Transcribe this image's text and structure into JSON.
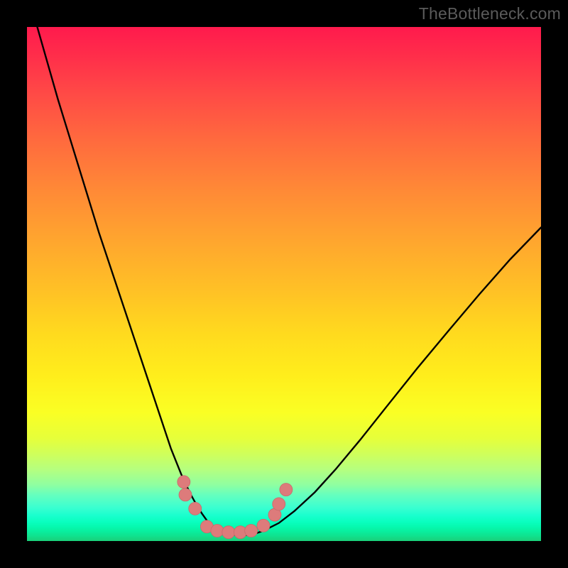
{
  "watermark": {
    "text": "TheBottleneck.com"
  },
  "colors": {
    "curve": "#000000",
    "markerFill": "#dd7b7b",
    "markerStroke": "#c86a6a",
    "gradientTop": "#ff1a4d",
    "gradientBottom": "#1ad07a"
  },
  "chart_data": {
    "type": "line",
    "title": "",
    "subtitle": "",
    "xlabel": "",
    "ylabel": "",
    "xlim": [
      0,
      100
    ],
    "ylim": [
      0,
      100
    ],
    "grid": false,
    "legend": false,
    "annotations": [],
    "series": [
      {
        "name": "bottleneck-curve",
        "x": [
          2,
          4,
          6,
          8,
          10,
          12,
          14,
          16,
          18,
          20,
          22,
          23.5,
          25,
          26,
          27,
          28,
          29,
          30,
          31,
          32,
          33,
          34,
          35,
          36,
          38,
          40,
          42,
          44,
          46,
          49,
          52,
          56,
          60,
          65,
          70,
          76,
          82,
          88,
          94,
          100
        ],
        "y": [
          100,
          93,
          86,
          79.5,
          73,
          66.5,
          60,
          54,
          48,
          42,
          36,
          31.5,
          27,
          24,
          21,
          18,
          15.5,
          13,
          10.8,
          8.8,
          7,
          5.4,
          4,
          3,
          1.8,
          1.2,
          1.1,
          1.3,
          2,
          3.5,
          5.8,
          9.5,
          13.9,
          19.9,
          26.2,
          33.7,
          40.9,
          48,
          54.8,
          61
        ]
      }
    ],
    "markers": [
      {
        "name": "left-pair-upper",
        "x": 30.5,
        "y": 11.5,
        "r": 9
      },
      {
        "name": "left-pair-lower",
        "x": 30.8,
        "y": 9.0,
        "r": 9
      },
      {
        "name": "left-single",
        "x": 32.7,
        "y": 6.3,
        "r": 9
      },
      {
        "name": "bottom-1",
        "x": 35.0,
        "y": 2.8,
        "r": 9
      },
      {
        "name": "bottom-2",
        "x": 37.0,
        "y": 2.0,
        "r": 9
      },
      {
        "name": "bottom-3",
        "x": 39.2,
        "y": 1.7,
        "r": 9
      },
      {
        "name": "bottom-4",
        "x": 41.5,
        "y": 1.7,
        "r": 9
      },
      {
        "name": "bottom-5",
        "x": 43.6,
        "y": 2.0,
        "r": 9
      },
      {
        "name": "right-single",
        "x": 46.0,
        "y": 3.0,
        "r": 9
      },
      {
        "name": "right-pair-lower",
        "x": 48.2,
        "y": 5.1,
        "r": 9
      },
      {
        "name": "right-pair-upper",
        "x": 49.0,
        "y": 7.2,
        "r": 9
      },
      {
        "name": "right-top",
        "x": 50.4,
        "y": 10.0,
        "r": 9
      }
    ]
  }
}
